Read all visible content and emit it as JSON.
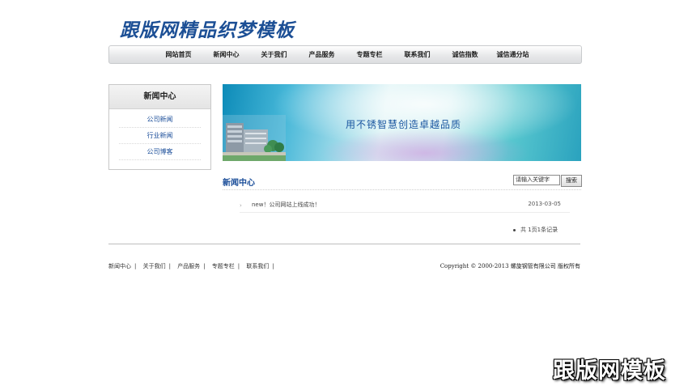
{
  "site": {
    "logo_text": "跟版网精品织梦模板"
  },
  "nav": {
    "items": [
      "网站首页",
      "新闻中心",
      "关于我们",
      "产品服务",
      "专题专栏",
      "联系我们",
      "诚信指数",
      "诚信通分站"
    ]
  },
  "sidebar": {
    "title": "新闻中心",
    "items": [
      "公司新闻",
      "行业新闻",
      "公司博客"
    ]
  },
  "banner": {
    "slogan": "用不锈智慧创造卓越品质"
  },
  "main": {
    "section_title": "新闻中心",
    "search": {
      "placeholder": "请输入关键字",
      "value": "请输入关键字",
      "button_label": "搜索"
    },
    "news": [
      {
        "title": "new！公司网站上线成功！",
        "date": "2013-03-05"
      }
    ],
    "pager_text": "共 1页1条记录"
  },
  "footer": {
    "links": [
      "新闻中心",
      "关于我们",
      "产品服务",
      "专题专栏",
      "联系我们"
    ],
    "separator": "|",
    "copyright": "Copyright © 2000-2013 螺旋钢管有限公司 版权所有"
  },
  "watermark": "跟版网模板",
  "colors": {
    "brand_blue": "#1a4d99",
    "banner_teal": "#46b7d8"
  }
}
